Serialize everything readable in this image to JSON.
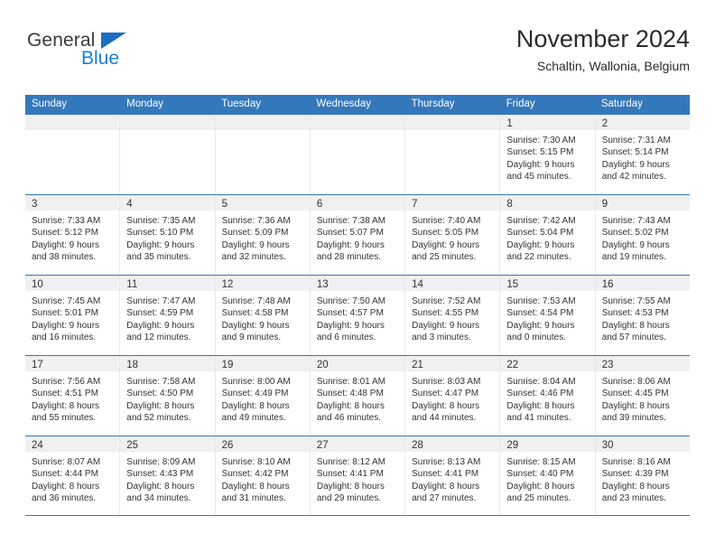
{
  "logo": {
    "primary_text": "General",
    "secondary_text": "Blue",
    "triangle_color": "#1b6ec2",
    "secondary_color": "#1b7fd4"
  },
  "header": {
    "title": "November 2024",
    "subtitle": "Schaltin, Wallonia, Belgium"
  },
  "theme": {
    "header_blue": "#3478bc",
    "day_band_gray": "#f0f0f0",
    "cell_border": "#e9e9e9"
  },
  "weekdays": [
    "Sunday",
    "Monday",
    "Tuesday",
    "Wednesday",
    "Thursday",
    "Friday",
    "Saturday"
  ],
  "weeks": [
    [
      {
        "day": "",
        "empty": true
      },
      {
        "day": "",
        "empty": true
      },
      {
        "day": "",
        "empty": true
      },
      {
        "day": "",
        "empty": true
      },
      {
        "day": "",
        "empty": true
      },
      {
        "day": "1",
        "sunrise": "Sunrise: 7:30 AM",
        "sunset": "Sunset: 5:15 PM",
        "daylight_1": "Daylight: 9 hours",
        "daylight_2": "and 45 minutes."
      },
      {
        "day": "2",
        "sunrise": "Sunrise: 7:31 AM",
        "sunset": "Sunset: 5:14 PM",
        "daylight_1": "Daylight: 9 hours",
        "daylight_2": "and 42 minutes."
      }
    ],
    [
      {
        "day": "3",
        "sunrise": "Sunrise: 7:33 AM",
        "sunset": "Sunset: 5:12 PM",
        "daylight_1": "Daylight: 9 hours",
        "daylight_2": "and 38 minutes."
      },
      {
        "day": "4",
        "sunrise": "Sunrise: 7:35 AM",
        "sunset": "Sunset: 5:10 PM",
        "daylight_1": "Daylight: 9 hours",
        "daylight_2": "and 35 minutes."
      },
      {
        "day": "5",
        "sunrise": "Sunrise: 7:36 AM",
        "sunset": "Sunset: 5:09 PM",
        "daylight_1": "Daylight: 9 hours",
        "daylight_2": "and 32 minutes."
      },
      {
        "day": "6",
        "sunrise": "Sunrise: 7:38 AM",
        "sunset": "Sunset: 5:07 PM",
        "daylight_1": "Daylight: 9 hours",
        "daylight_2": "and 28 minutes."
      },
      {
        "day": "7",
        "sunrise": "Sunrise: 7:40 AM",
        "sunset": "Sunset: 5:05 PM",
        "daylight_1": "Daylight: 9 hours",
        "daylight_2": "and 25 minutes."
      },
      {
        "day": "8",
        "sunrise": "Sunrise: 7:42 AM",
        "sunset": "Sunset: 5:04 PM",
        "daylight_1": "Daylight: 9 hours",
        "daylight_2": "and 22 minutes."
      },
      {
        "day": "9",
        "sunrise": "Sunrise: 7:43 AM",
        "sunset": "Sunset: 5:02 PM",
        "daylight_1": "Daylight: 9 hours",
        "daylight_2": "and 19 minutes."
      }
    ],
    [
      {
        "day": "10",
        "sunrise": "Sunrise: 7:45 AM",
        "sunset": "Sunset: 5:01 PM",
        "daylight_1": "Daylight: 9 hours",
        "daylight_2": "and 16 minutes."
      },
      {
        "day": "11",
        "sunrise": "Sunrise: 7:47 AM",
        "sunset": "Sunset: 4:59 PM",
        "daylight_1": "Daylight: 9 hours",
        "daylight_2": "and 12 minutes."
      },
      {
        "day": "12",
        "sunrise": "Sunrise: 7:48 AM",
        "sunset": "Sunset: 4:58 PM",
        "daylight_1": "Daylight: 9 hours",
        "daylight_2": "and 9 minutes."
      },
      {
        "day": "13",
        "sunrise": "Sunrise: 7:50 AM",
        "sunset": "Sunset: 4:57 PM",
        "daylight_1": "Daylight: 9 hours",
        "daylight_2": "and 6 minutes."
      },
      {
        "day": "14",
        "sunrise": "Sunrise: 7:52 AM",
        "sunset": "Sunset: 4:55 PM",
        "daylight_1": "Daylight: 9 hours",
        "daylight_2": "and 3 minutes."
      },
      {
        "day": "15",
        "sunrise": "Sunrise: 7:53 AM",
        "sunset": "Sunset: 4:54 PM",
        "daylight_1": "Daylight: 9 hours",
        "daylight_2": "and 0 minutes."
      },
      {
        "day": "16",
        "sunrise": "Sunrise: 7:55 AM",
        "sunset": "Sunset: 4:53 PM",
        "daylight_1": "Daylight: 8 hours",
        "daylight_2": "and 57 minutes."
      }
    ],
    [
      {
        "day": "17",
        "sunrise": "Sunrise: 7:56 AM",
        "sunset": "Sunset: 4:51 PM",
        "daylight_1": "Daylight: 8 hours",
        "daylight_2": "and 55 minutes."
      },
      {
        "day": "18",
        "sunrise": "Sunrise: 7:58 AM",
        "sunset": "Sunset: 4:50 PM",
        "daylight_1": "Daylight: 8 hours",
        "daylight_2": "and 52 minutes."
      },
      {
        "day": "19",
        "sunrise": "Sunrise: 8:00 AM",
        "sunset": "Sunset: 4:49 PM",
        "daylight_1": "Daylight: 8 hours",
        "daylight_2": "and 49 minutes."
      },
      {
        "day": "20",
        "sunrise": "Sunrise: 8:01 AM",
        "sunset": "Sunset: 4:48 PM",
        "daylight_1": "Daylight: 8 hours",
        "daylight_2": "and 46 minutes."
      },
      {
        "day": "21",
        "sunrise": "Sunrise: 8:03 AM",
        "sunset": "Sunset: 4:47 PM",
        "daylight_1": "Daylight: 8 hours",
        "daylight_2": "and 44 minutes."
      },
      {
        "day": "22",
        "sunrise": "Sunrise: 8:04 AM",
        "sunset": "Sunset: 4:46 PM",
        "daylight_1": "Daylight: 8 hours",
        "daylight_2": "and 41 minutes."
      },
      {
        "day": "23",
        "sunrise": "Sunrise: 8:06 AM",
        "sunset": "Sunset: 4:45 PM",
        "daylight_1": "Daylight: 8 hours",
        "daylight_2": "and 39 minutes."
      }
    ],
    [
      {
        "day": "24",
        "sunrise": "Sunrise: 8:07 AM",
        "sunset": "Sunset: 4:44 PM",
        "daylight_1": "Daylight: 8 hours",
        "daylight_2": "and 36 minutes."
      },
      {
        "day": "25",
        "sunrise": "Sunrise: 8:09 AM",
        "sunset": "Sunset: 4:43 PM",
        "daylight_1": "Daylight: 8 hours",
        "daylight_2": "and 34 minutes."
      },
      {
        "day": "26",
        "sunrise": "Sunrise: 8:10 AM",
        "sunset": "Sunset: 4:42 PM",
        "daylight_1": "Daylight: 8 hours",
        "daylight_2": "and 31 minutes."
      },
      {
        "day": "27",
        "sunrise": "Sunrise: 8:12 AM",
        "sunset": "Sunset: 4:41 PM",
        "daylight_1": "Daylight: 8 hours",
        "daylight_2": "and 29 minutes."
      },
      {
        "day": "28",
        "sunrise": "Sunrise: 8:13 AM",
        "sunset": "Sunset: 4:41 PM",
        "daylight_1": "Daylight: 8 hours",
        "daylight_2": "and 27 minutes."
      },
      {
        "day": "29",
        "sunrise": "Sunrise: 8:15 AM",
        "sunset": "Sunset: 4:40 PM",
        "daylight_1": "Daylight: 8 hours",
        "daylight_2": "and 25 minutes."
      },
      {
        "day": "30",
        "sunrise": "Sunrise: 8:16 AM",
        "sunset": "Sunset: 4:39 PM",
        "daylight_1": "Daylight: 8 hours",
        "daylight_2": "and 23 minutes."
      }
    ]
  ]
}
